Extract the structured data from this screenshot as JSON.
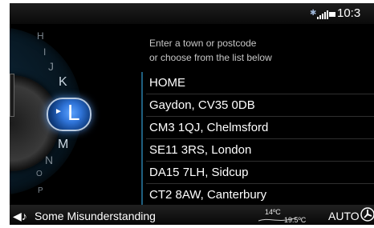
{
  "status": {
    "time": "10:3",
    "bluetooth_icon": "bluetooth-icon",
    "signal_icon": "signal-icon",
    "battery_icon": "battery-icon"
  },
  "alphabet_dial": {
    "letters_above": [
      "H",
      "I",
      "J",
      "K"
    ],
    "active": "L",
    "letters_below": [
      "M",
      "N",
      "O",
      "P"
    ]
  },
  "prompt": {
    "line1": "Enter a town or postcode",
    "line2": "or choose from the list below"
  },
  "list": [
    "HOME",
    "Gaydon, CV35 0DB",
    "CM3 1QJ, Chelmsford",
    "SE11 3RS, London",
    "DA15 7LH, Sidcup",
    "CT2 8AW, Canterbury"
  ],
  "bottom": {
    "music_icon": "music-icon",
    "track": "Some Misunderstanding",
    "temp_left": "14ºC",
    "temp_right": "19.5ºC",
    "auto": "AUTO",
    "fan_icon": "fan-icon"
  }
}
